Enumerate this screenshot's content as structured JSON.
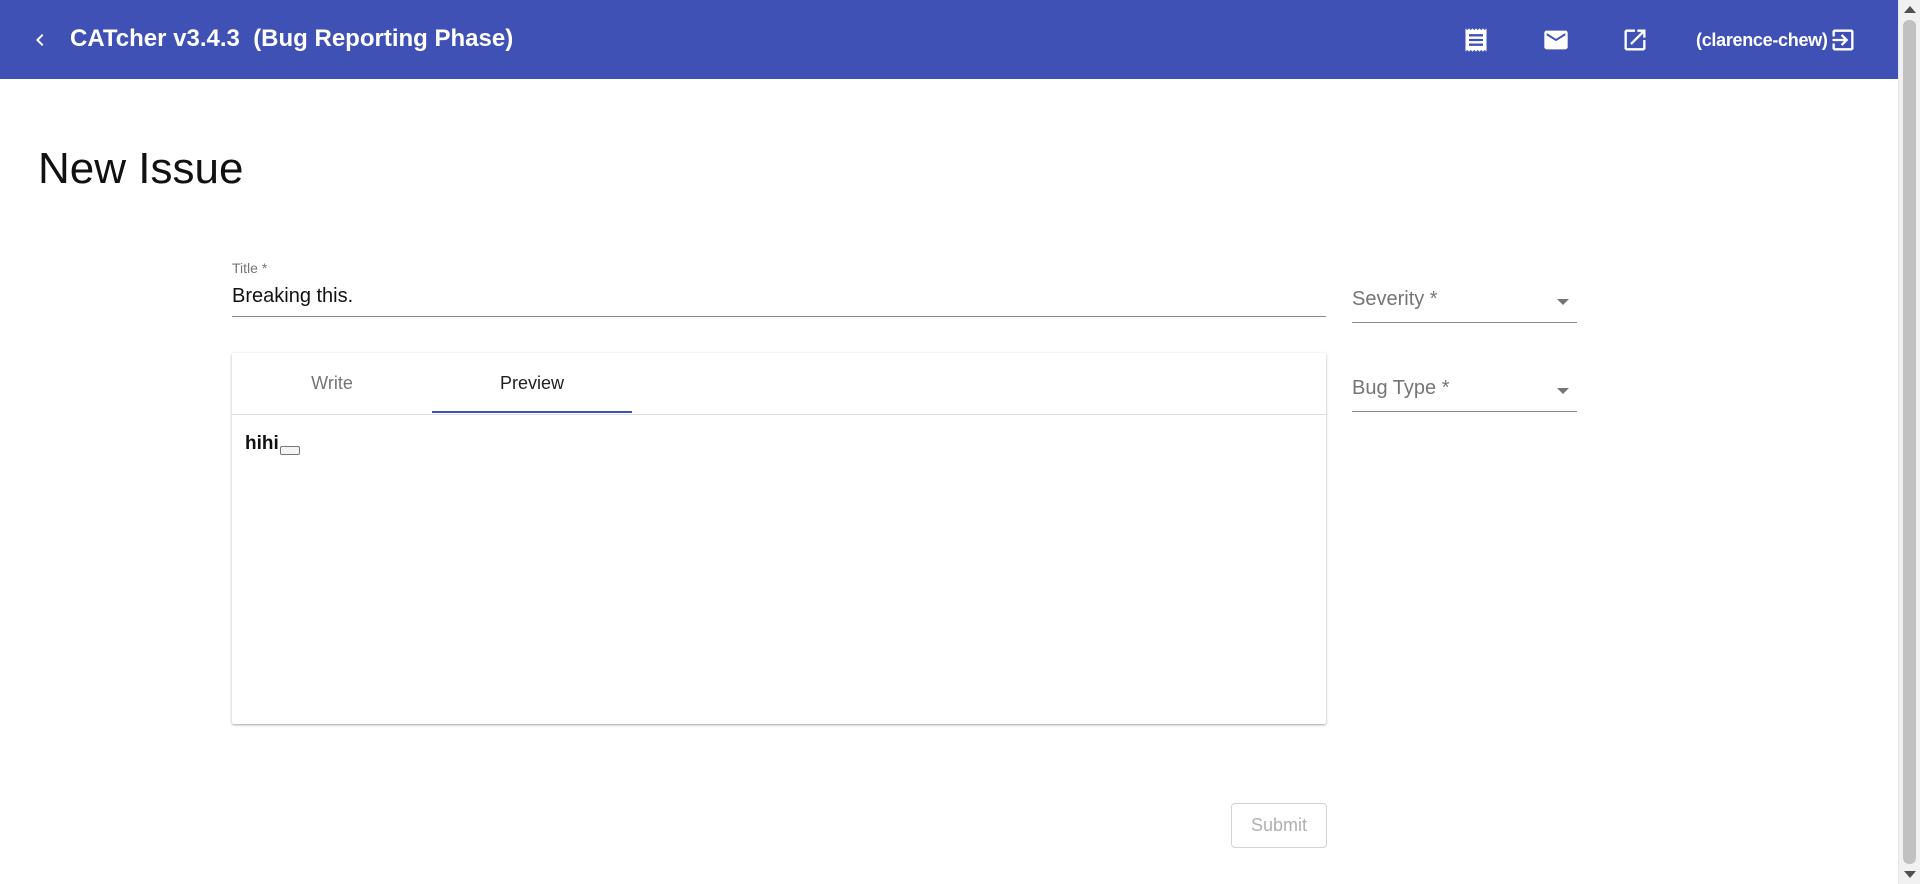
{
  "toolbar": {
    "app_title": "CATcher v3.4.3  (Bug Reporting Phase)",
    "username": "(clarence-chew)",
    "icons": [
      "back-arrow-icon",
      "receipt-icon",
      "mail-icon",
      "open-in-new-icon",
      "logout-icon"
    ],
    "background_color": "#3f51b5"
  },
  "page": {
    "title": "New Issue"
  },
  "form": {
    "title_label": "Title *",
    "title_value": "Breaking this.",
    "severity_placeholder": "Severity *",
    "bug_type_placeholder": "Bug Type *",
    "tabs": [
      {
        "label": "Write",
        "active": false
      },
      {
        "label": "Preview",
        "active": true
      }
    ],
    "preview_text": "hihi",
    "submit_label": "Submit"
  }
}
